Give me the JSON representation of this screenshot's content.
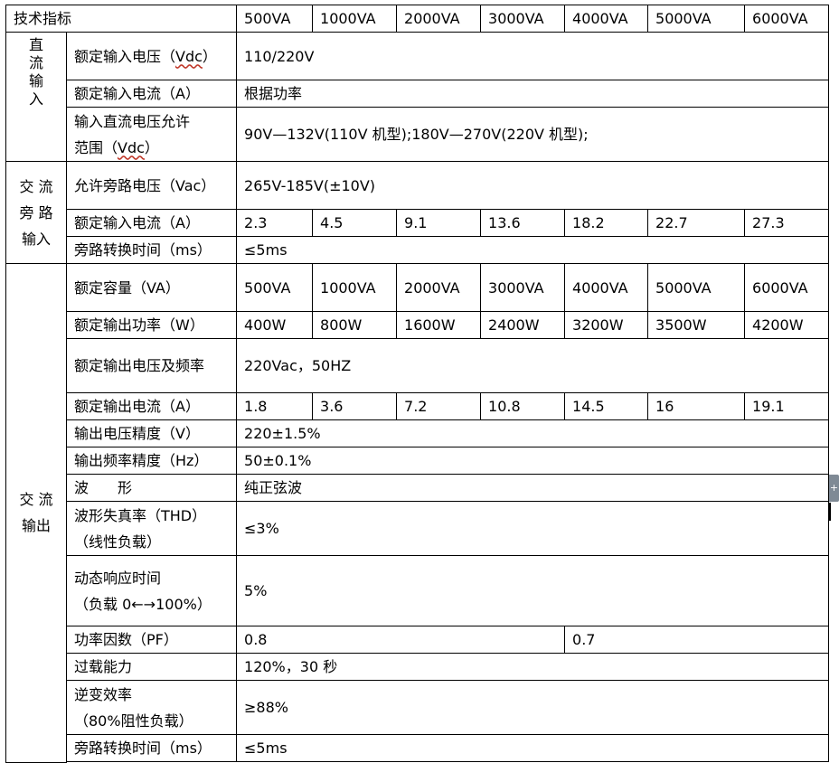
{
  "header": {
    "label": "技术指标",
    "models": [
      "500VA",
      "1000VA",
      "2000VA",
      "3000VA",
      "4000VA",
      "5000VA",
      "6000VA"
    ]
  },
  "dc_input": {
    "group": [
      "直",
      "流",
      "输",
      "入"
    ],
    "rated_voltage_label_pre": "额定输入电压（",
    "rated_voltage_unit": "Vdc",
    "rated_voltage_label_post": "）",
    "rated_voltage": "110/220V",
    "rated_current_label": "额定输入电流（A）",
    "rated_current": "根据功率",
    "range_label_line1": "输入直流电压允许",
    "range_label_line2_pre": "范围（",
    "range_label_unit": "Vdc",
    "range_label_line2_post": "）",
    "range": "90V—132V(110V 机型);180V—270V(220V 机型);"
  },
  "ac_bypass": {
    "group_line1": "交 流",
    "group_line2": "旁 路",
    "group_line3": "输入",
    "voltage_label": "允许旁路电压（Vac）",
    "voltage": "265V-185V(±10V)",
    "current_label": "额定输入电流（A）",
    "currents": [
      "2.3",
      "4.5",
      "9.1",
      "13.6",
      "18.2",
      "22.7",
      "27.3"
    ],
    "transfer_label": "旁路转换时间（ms）",
    "transfer": "≤5ms"
  },
  "ac_output": {
    "group_line1": "交 流",
    "group_line2": "输出",
    "capacity_label": "额定容量（VA）",
    "capacities": [
      "500VA",
      "1000VA",
      "2000VA",
      "3000VA",
      "4000VA",
      "5000VA",
      "6000VA"
    ],
    "power_label": "额定输出功率（W）",
    "powers": [
      "400W",
      "800W",
      "1600W",
      "2400W",
      "3200W",
      "3500W",
      "4200W"
    ],
    "vf_label": "额定输出电压及频率",
    "vf": "220Vac，50HZ",
    "current_label": "额定输出电流（A）",
    "currents": [
      "1.8",
      "3.6",
      "7.2",
      "10.8",
      "14.5",
      "16",
      "19.1"
    ],
    "v_accuracy_label": "输出电压精度（V）",
    "v_accuracy": "220±1.5%",
    "f_accuracy_label": "输出频率精度（Hz）",
    "f_accuracy": "50±0.1%",
    "waveform_label": "波　　形",
    "waveform": "纯正弦波",
    "thd_label_line1": "波形失真率（THD）",
    "thd_label_line2": "（线性负载）",
    "thd": "≤3%",
    "response_label_line1": "动态响应时间",
    "response_label_line2": "（负载 0←→100%）",
    "response": "5%",
    "pf_label": "功率因数（PF）",
    "pf_low": "0.8",
    "pf_high": "0.7",
    "overload_label": "过载能力",
    "overload": "120%，30 秒",
    "efficiency_label_line1": "逆变效率",
    "efficiency_label_line2": "（80%阻性负载）",
    "efficiency": "≥88%",
    "transfer_label": "旁路转换时间（ms）",
    "transfer": "≤5ms"
  },
  "side_handle_icon": "plus-icon"
}
